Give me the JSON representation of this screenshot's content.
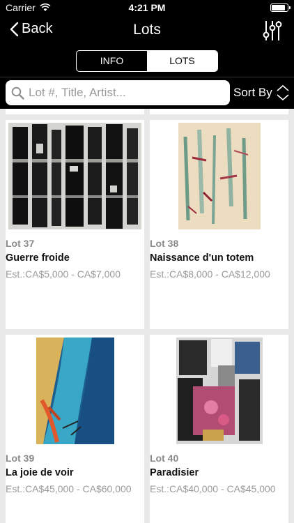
{
  "status": {
    "carrier": "Carrier",
    "time": "4:21 PM",
    "battery_level": 0.95
  },
  "nav": {
    "back_label": "Back",
    "title": "Lots"
  },
  "segments": [
    {
      "label": "INFO",
      "active": false
    },
    {
      "label": "LOTS",
      "active": true
    }
  ],
  "search": {
    "placeholder": "Lot #, Title, Artist...",
    "value": "",
    "sort_label": "Sort By"
  },
  "lots": [
    {
      "number": "Lot 37",
      "title": "Guerre froide",
      "estimate": "Est.:CA$5,000 - CA$7,000",
      "image": "black-white-abstract"
    },
    {
      "number": "Lot 38",
      "title": "Naissance d'un totem",
      "estimate": "Est.:CA$8,000 - CA$12,000",
      "image": "pale-totem-abstract"
    },
    {
      "number": "Lot 39",
      "title": "La joie de voir",
      "estimate": "Est.:CA$45,000 - CA$60,000",
      "image": "blue-orange-abstract"
    },
    {
      "number": "Lot 40",
      "title": "Paradisier",
      "estimate": "Est.:CA$40,000 - CA$45,000",
      "image": "collage-abstract"
    }
  ]
}
